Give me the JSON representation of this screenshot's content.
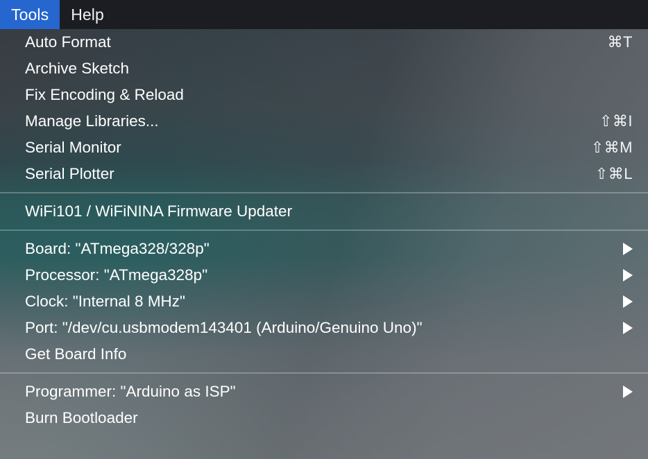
{
  "menubar": {
    "items": [
      {
        "label": "Tools",
        "active": true
      },
      {
        "label": "Help",
        "active": false
      }
    ]
  },
  "colors": {
    "menubar_background": "#1b1d22",
    "menubar_highlight": "#2566cf",
    "menu_text": "#ffffff",
    "panel_top": "#383c43",
    "panel_teal": "#2d5c5d",
    "panel_bottom": "#7b7e81",
    "separator": "rgba(255,255,255,0.26)"
  },
  "menu": {
    "title": "Tools",
    "groups": [
      {
        "name": "sketch-tools",
        "items": [
          {
            "label": "Auto Format",
            "shortcut": "⌘T",
            "submenu": false
          },
          {
            "label": "Archive Sketch",
            "shortcut": "",
            "submenu": false
          },
          {
            "label": "Fix Encoding & Reload",
            "shortcut": "",
            "submenu": false
          },
          {
            "label": "Manage Libraries...",
            "shortcut": "⇧⌘I",
            "submenu": false
          },
          {
            "label": "Serial Monitor",
            "shortcut": "⇧⌘M",
            "submenu": false
          },
          {
            "label": "Serial Plotter",
            "shortcut": "⇧⌘L",
            "submenu": false
          }
        ]
      },
      {
        "name": "firmware-tools",
        "items": [
          {
            "label": "WiFi101 / WiFiNINA Firmware Updater",
            "shortcut": "",
            "submenu": false
          }
        ]
      },
      {
        "name": "board-configuration",
        "items": [
          {
            "label": "Board: \"ATmega328/328p\"",
            "shortcut": "",
            "submenu": true
          },
          {
            "label": "Processor: \"ATmega328p\"",
            "shortcut": "",
            "submenu": true
          },
          {
            "label": "Clock: \"Internal 8 MHz\"",
            "shortcut": "",
            "submenu": true
          },
          {
            "label": "Port: \"/dev/cu.usbmodem143401 (Arduino/Genuino Uno)\"",
            "shortcut": "",
            "submenu": true
          },
          {
            "label": "Get Board Info",
            "shortcut": "",
            "submenu": false
          }
        ]
      },
      {
        "name": "programmer-tools",
        "items": [
          {
            "label": "Programmer: \"Arduino as ISP\"",
            "shortcut": "",
            "submenu": true
          },
          {
            "label": "Burn Bootloader",
            "shortcut": "",
            "submenu": false
          }
        ]
      }
    ]
  }
}
